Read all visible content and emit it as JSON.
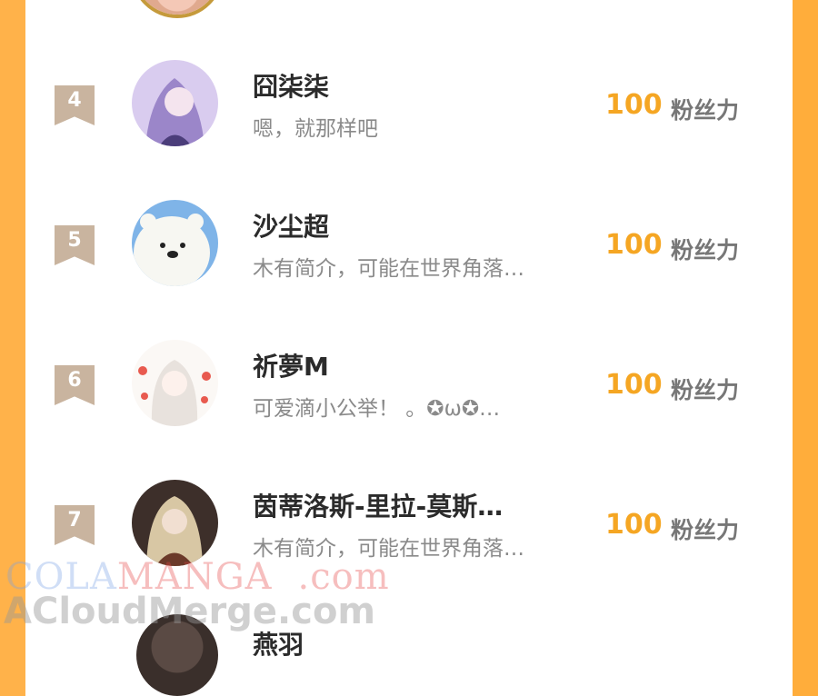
{
  "ranking": {
    "rows": [
      {
        "rank": "4",
        "name": "囧柒柒",
        "bio": "嗯，就那样吧",
        "score": "100",
        "unit": "粉丝力",
        "avatar_color": "#c9b8e6"
      },
      {
        "rank": "5",
        "name": "沙尘超",
        "bio": "木有简介，可能在世界角落…",
        "score": "100",
        "unit": "粉丝力",
        "avatar_color": "#7fb4e8"
      },
      {
        "rank": "6",
        "name": "祈夢M",
        "bio": "可爱滴小公举！ 。✪ω✪…",
        "score": "100",
        "unit": "粉丝力",
        "avatar_color": "#f3ede8"
      },
      {
        "rank": "7",
        "name": "茵蒂洛斯-里拉-莫斯…",
        "bio": "木有简介，可能在世界角落…",
        "score": "100",
        "unit": "粉丝力",
        "avatar_color": "#4b3a33"
      }
    ],
    "next_row_name": "燕羽"
  },
  "watermark": {
    "line1_a": "COLA",
    "line1_b": "MANGA",
    "line1_c": ".com",
    "line2": "ACloudMerge.com"
  },
  "colors": {
    "accent": "#f5a623",
    "rank_badge": "#c9b49f",
    "side_border": "#ffad3b"
  }
}
